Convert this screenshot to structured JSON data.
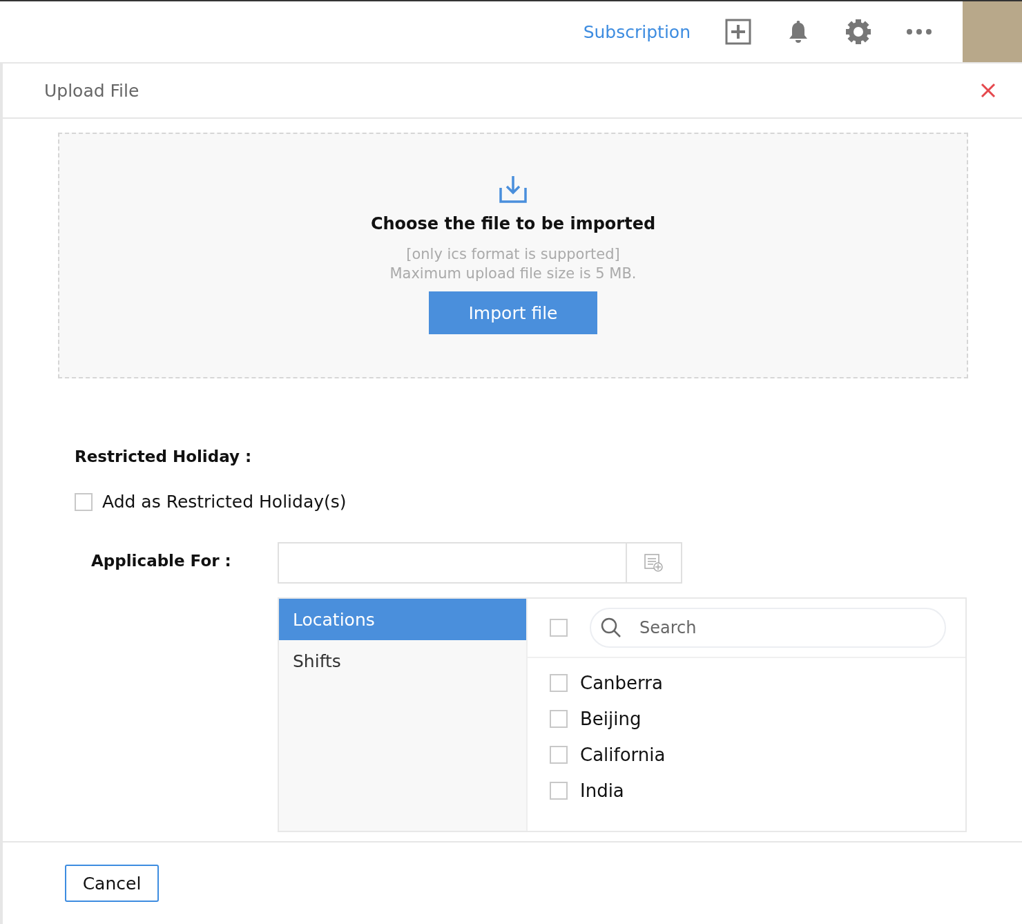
{
  "topbar": {
    "subscription_link": "Subscription"
  },
  "dialog": {
    "title": "Upload File",
    "dropzone": {
      "heading": "Choose the file to be imported",
      "notes": [
        "[only ics format is supported]",
        "Maximum upload file size is 5 MB."
      ],
      "button": "Import file"
    },
    "restricted": {
      "label": "Restricted Holiday :",
      "checkbox": {
        "label": "Add as Restricted Holiday(s)",
        "checked": false
      }
    },
    "applicable": {
      "label": "Applicable For :",
      "categories": [
        {
          "label": "Locations",
          "selected": true
        },
        {
          "label": "Shifts",
          "selected": false
        }
      ],
      "select_all": {
        "checked": false
      },
      "search": {
        "placeholder": "Search"
      },
      "options": [
        {
          "label": "Canberra",
          "checked": false
        },
        {
          "label": "Beijing",
          "checked": false
        },
        {
          "label": "California",
          "checked": false
        },
        {
          "label": "India",
          "checked": false
        }
      ]
    },
    "cancel_button": "Cancel"
  }
}
